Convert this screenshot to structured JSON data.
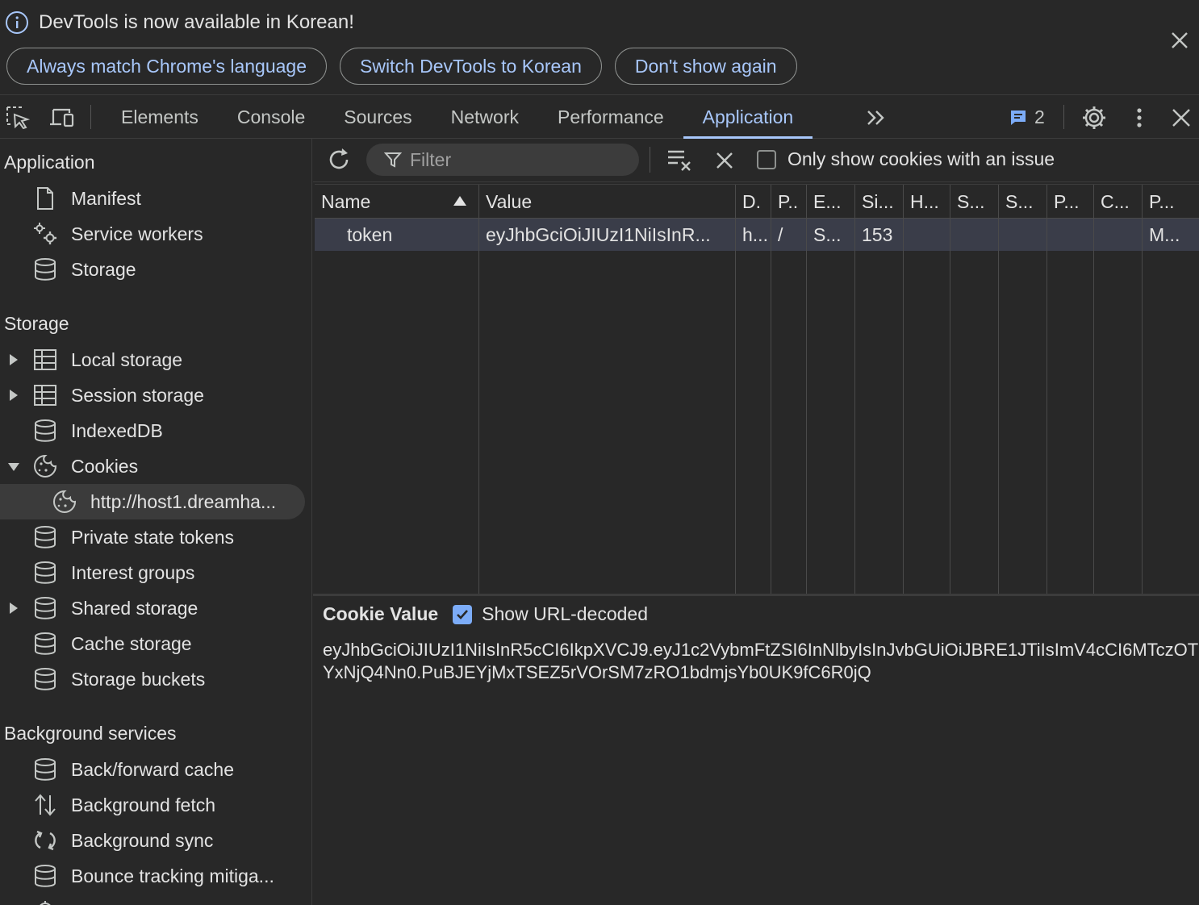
{
  "infobar": {
    "message": "DevTools is now available in Korean!",
    "buttons": [
      "Always match Chrome's language",
      "Switch DevTools to Korean",
      "Don't show again"
    ]
  },
  "tabs": [
    "Elements",
    "Console",
    "Sources",
    "Network",
    "Performance",
    "Application"
  ],
  "active_tab": "Application",
  "issues_count": "2",
  "sidebar": {
    "sections": [
      {
        "title": "Application",
        "items": [
          "Manifest",
          "Service workers",
          "Storage"
        ]
      },
      {
        "title": "Storage",
        "items": [
          "Local storage",
          "Session storage",
          "IndexedDB",
          "Cookies",
          "http://host1.dreamha...",
          "Private state tokens",
          "Interest groups",
          "Shared storage",
          "Cache storage",
          "Storage buckets"
        ]
      },
      {
        "title": "Background services",
        "items": [
          "Back/forward cache",
          "Background fetch",
          "Background sync",
          "Bounce tracking mitiga..."
        ]
      }
    ]
  },
  "toolbar": {
    "filter_placeholder": "Filter",
    "only_issue_label": "Only show cookies with an issue"
  },
  "table": {
    "headers": [
      "Name",
      "Value",
      "D.",
      "P..",
      "E...",
      "Si...",
      "H...",
      "S...",
      "S...",
      "P...",
      "C...",
      "P..."
    ],
    "rows": [
      [
        "token",
        "eyJhbGciOiJIUzI1NiIsInR...",
        "h...",
        "/",
        "S...",
        "153",
        "",
        "",
        "",
        "",
        "",
        "M..."
      ]
    ]
  },
  "cookie_value": {
    "title": "Cookie Value",
    "decode_label": "Show URL-decoded",
    "value": "eyJhbGciOiJIUzI1NiIsInR5cCI6IkpXVCJ9.eyJ1c2VybmFtZSI6InNlbyIsInJvbGUiOiJBRE1JTiIsImV4cCI6MTczOTYxNjQ4Nn0.PuBJEYjMxTSEZ5rVOrSM7zRO1bdmjsYb0UK9fC6R0jQ"
  },
  "colors": {
    "background": "#282828",
    "accent": "#a8c7fa",
    "selected_row": "#3a3d49"
  }
}
